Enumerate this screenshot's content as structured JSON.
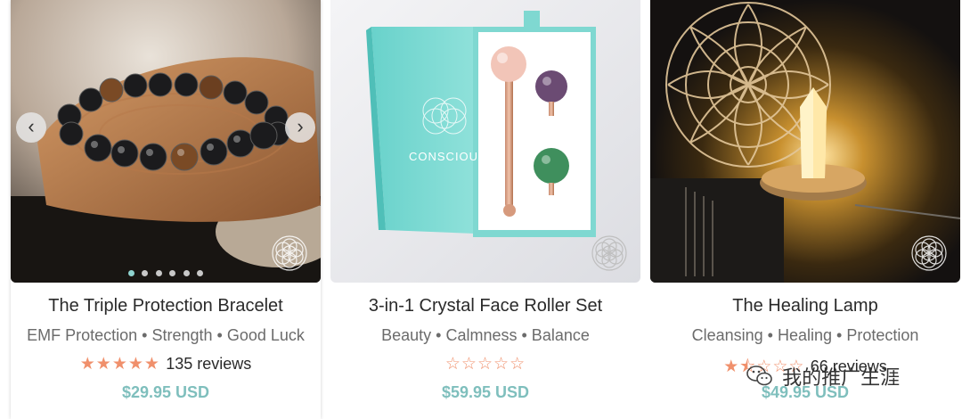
{
  "products": [
    {
      "title": "The Triple Protection Bracelet",
      "tags": "EMF Protection • Strength • Good Luck",
      "rating_stars": 5,
      "reviews_label": "135 reviews",
      "price": "$29.95 USD",
      "image_name": "bracelet-photo",
      "carousel": {
        "prev_icon": "chevron-left-icon",
        "next_icon": "chevron-right-icon",
        "slide_count": 6,
        "active_slide": 1
      }
    },
    {
      "title": "3-in-1 Crystal Face Roller Set",
      "tags": "Beauty • Calmness • Balance",
      "rating_stars": 0,
      "reviews_label": "",
      "price": "$59.95 USD",
      "image_name": "face-roller-photo",
      "box_brand": "CONSCIOUS"
    },
    {
      "title": "The Healing Lamp",
      "tags": "Cleansing • Healing • Protection",
      "rating_stars": 1.5,
      "reviews_label": "66 reviews",
      "price": "$49.95 USD",
      "image_name": "healing-lamp-photo"
    }
  ],
  "overlay": {
    "watermark_text": "我的推广生涯",
    "icon": "wechat-icon"
  },
  "colors": {
    "star": "#f0906c",
    "price": "#7fbfbd",
    "accent": "#8fd3cf"
  }
}
